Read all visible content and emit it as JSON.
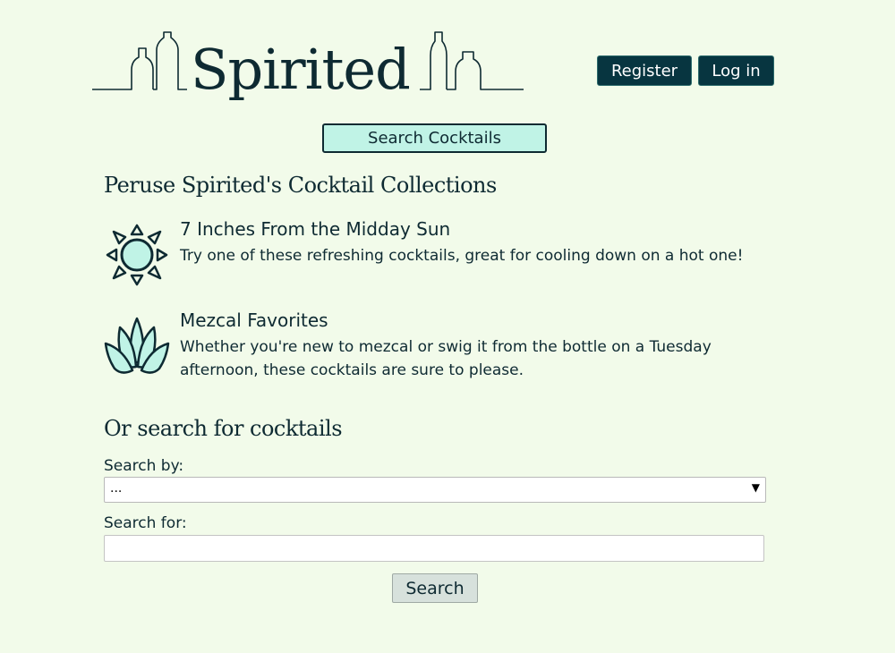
{
  "brand": {
    "name": "Spirited",
    "logo_icon": "bottle-silhouettes-icon"
  },
  "header": {
    "register_label": "Register",
    "login_label": "Log in"
  },
  "search_cocktails_label": "Search Cocktails",
  "collections": {
    "heading": "Peruse Spirited's Cocktail Collections",
    "items": [
      {
        "icon": "sun-icon",
        "title": "7 Inches From the Midday Sun",
        "description": "Try one of these refreshing cocktails, great for cooling down on a hot one!"
      },
      {
        "icon": "agave-icon",
        "title": "Mezcal Favorites",
        "description": "Whether you're new to mezcal or swig it from the bottle on a Tuesday afternoon, these cocktails are sure to please."
      }
    ]
  },
  "search_form": {
    "heading": "Or search for cocktails",
    "search_by_label": "Search by:",
    "search_by_value": "...",
    "search_for_label": "Search for:",
    "search_for_value": "",
    "submit_label": "Search"
  },
  "colors": {
    "background": "#f2fbea",
    "dark_teal": "#073540",
    "mint": "#c0f3e6",
    "text": "#0e2a32"
  }
}
